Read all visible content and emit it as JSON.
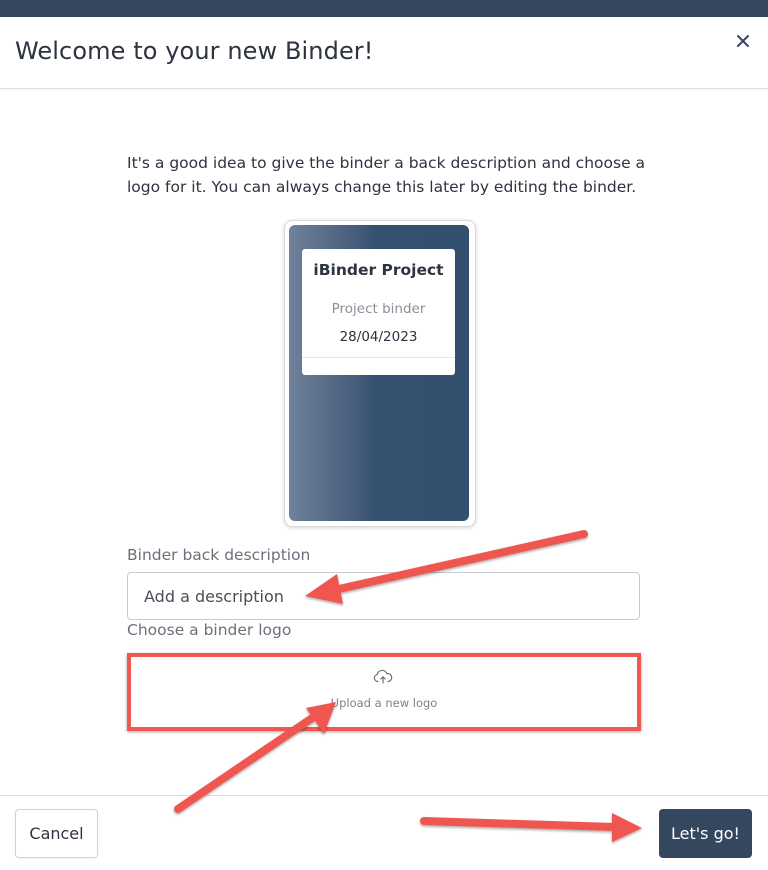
{
  "dialog": {
    "title": "Welcome to your new Binder!",
    "close_icon": "close-icon",
    "intro": "It's a good idea to give the binder a back description and choose a logo for it. You can always change this later by editing the binder."
  },
  "binder_preview": {
    "title": "iBinder Project",
    "subtitle": "Project binder",
    "date": "28/04/2023"
  },
  "form": {
    "description_label": "Binder back description",
    "description_placeholder": "Add a description",
    "description_value": "",
    "logo_label": "Choose a binder logo",
    "upload_label": "Upload a new logo",
    "upload_icon": "cloud-upload-icon"
  },
  "footer": {
    "cancel_label": "Cancel",
    "submit_label": "Let's go!"
  },
  "colors": {
    "primary": "#34475f",
    "annotation": "#ef5750"
  }
}
